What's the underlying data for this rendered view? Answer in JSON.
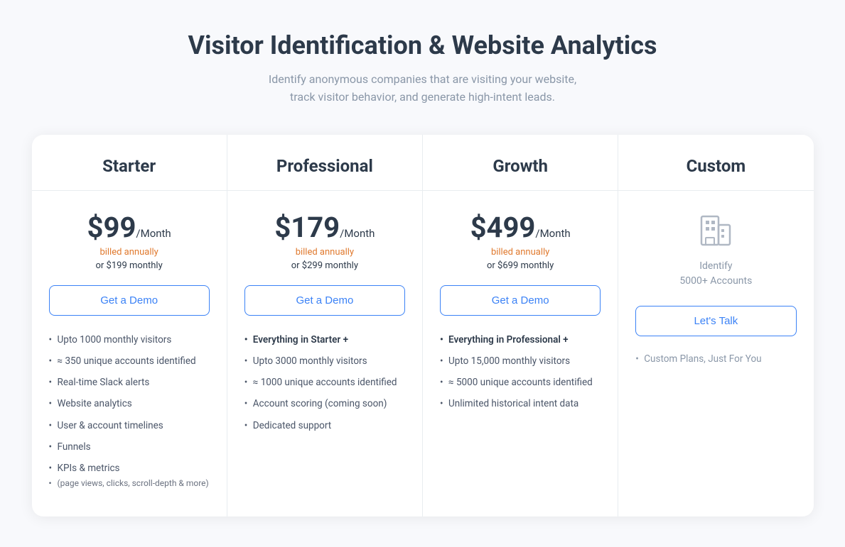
{
  "header": {
    "title": "Visitor Identification & Website Analytics",
    "subtitle_line1": "Identify anonymous companies that are visiting your website,",
    "subtitle_line2": "track visitor behavior, and generate high-intent leads."
  },
  "plans": [
    {
      "id": "starter",
      "name": "Starter",
      "price": "$99",
      "period": "/Month",
      "billed": "billed annually",
      "monthly": "or $199 monthly",
      "cta": "Get a Demo",
      "features": [
        {
          "text": "Upto 1000 monthly visitors",
          "bold": false
        },
        {
          "text": "≈ 350 unique accounts identified",
          "bold": false
        },
        {
          "text": "Real-time Slack alerts",
          "bold": false
        },
        {
          "text": "Website analytics",
          "bold": false
        },
        {
          "text": "User & account timelines",
          "bold": false
        },
        {
          "text": "Funnels",
          "bold": false
        },
        {
          "text": "KPIs & metrics",
          "bold": false
        },
        {
          "text": "(page views, clicks, scroll-depth & more)",
          "bold": false,
          "sub": true
        }
      ]
    },
    {
      "id": "professional",
      "name": "Professional",
      "price": "$179",
      "period": "/Month",
      "billed": "billed annually",
      "monthly": "or $299 monthly",
      "cta": "Get a Demo",
      "features": [
        {
          "text": "Everything in Starter +",
          "bold": true
        },
        {
          "text": "Upto 3000 monthly visitors",
          "bold": false
        },
        {
          "text": "≈ 1000 unique accounts identified",
          "bold": false
        },
        {
          "text": "Account scoring (coming soon)",
          "bold": false
        },
        {
          "text": "Dedicated support",
          "bold": false
        }
      ]
    },
    {
      "id": "growth",
      "name": "Growth",
      "price": "$499",
      "period": "/Month",
      "billed": "billed annually",
      "monthly": "or $699 monthly",
      "cta": "Get a Demo",
      "features": [
        {
          "text": "Everything in Professional +",
          "bold": true
        },
        {
          "text": "Upto 15,000 monthly visitors",
          "bold": false
        },
        {
          "text": "≈ 5000 unique accounts identified",
          "bold": false
        },
        {
          "text": "Unlimited historical intent data",
          "bold": false
        }
      ]
    },
    {
      "id": "custom",
      "name": "Custom",
      "icon": "🏢",
      "icon_label": "Identify\n5000+ Accounts",
      "cta": "Let's Talk",
      "features": [
        {
          "text": "Custom Plans, Just For You",
          "bold": false
        }
      ]
    }
  ]
}
